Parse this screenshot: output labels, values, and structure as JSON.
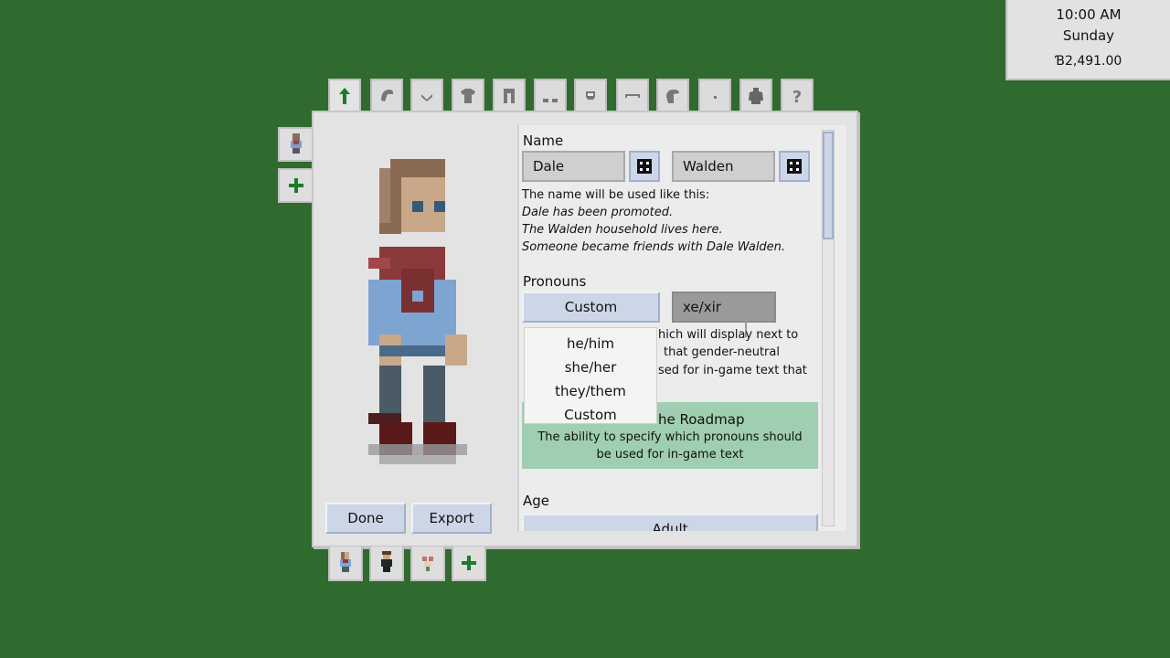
{
  "clock": {
    "time": "10:00 AM",
    "day": "Sunday",
    "money": "Ɓ2,491.00"
  },
  "tabs": [
    "body-icon",
    "hair-icon",
    "beard-icon",
    "shirt-icon",
    "pants-icon",
    "shoes-icon",
    "hat-icon",
    "eyebrows-icon",
    "head-icon",
    "eye-icon",
    "outfit-icon",
    "help-icon"
  ],
  "name": {
    "label": "Name",
    "first": "Dale",
    "last": "Walden",
    "usage_intro": "The name will be used like this:",
    "example1": "Dale has been promoted.",
    "example2": "The Walden household lives here.",
    "example3": "Someone became friends with Dale Walden."
  },
  "pronouns": {
    "label": "Pronouns",
    "selected": "Custom",
    "custom_value": "xe/xir",
    "desc1": "hich will display next to",
    "desc2": "that gender-neutral",
    "desc3": "sed for in-game text that",
    "options": [
      "he/him",
      "she/her",
      "they/them",
      "Custom"
    ]
  },
  "roadmap": {
    "title": "he Roadmap",
    "line1": "The ability to specify which pronouns should",
    "line2": "be used for in-game text"
  },
  "age": {
    "label": "Age",
    "value": "Adult"
  },
  "buttons": {
    "done": "Done",
    "export": "Export"
  },
  "colors": {
    "background": "#2f6a2e",
    "accent": "#cdd6e6",
    "roadmap": "#9fcfb0"
  }
}
